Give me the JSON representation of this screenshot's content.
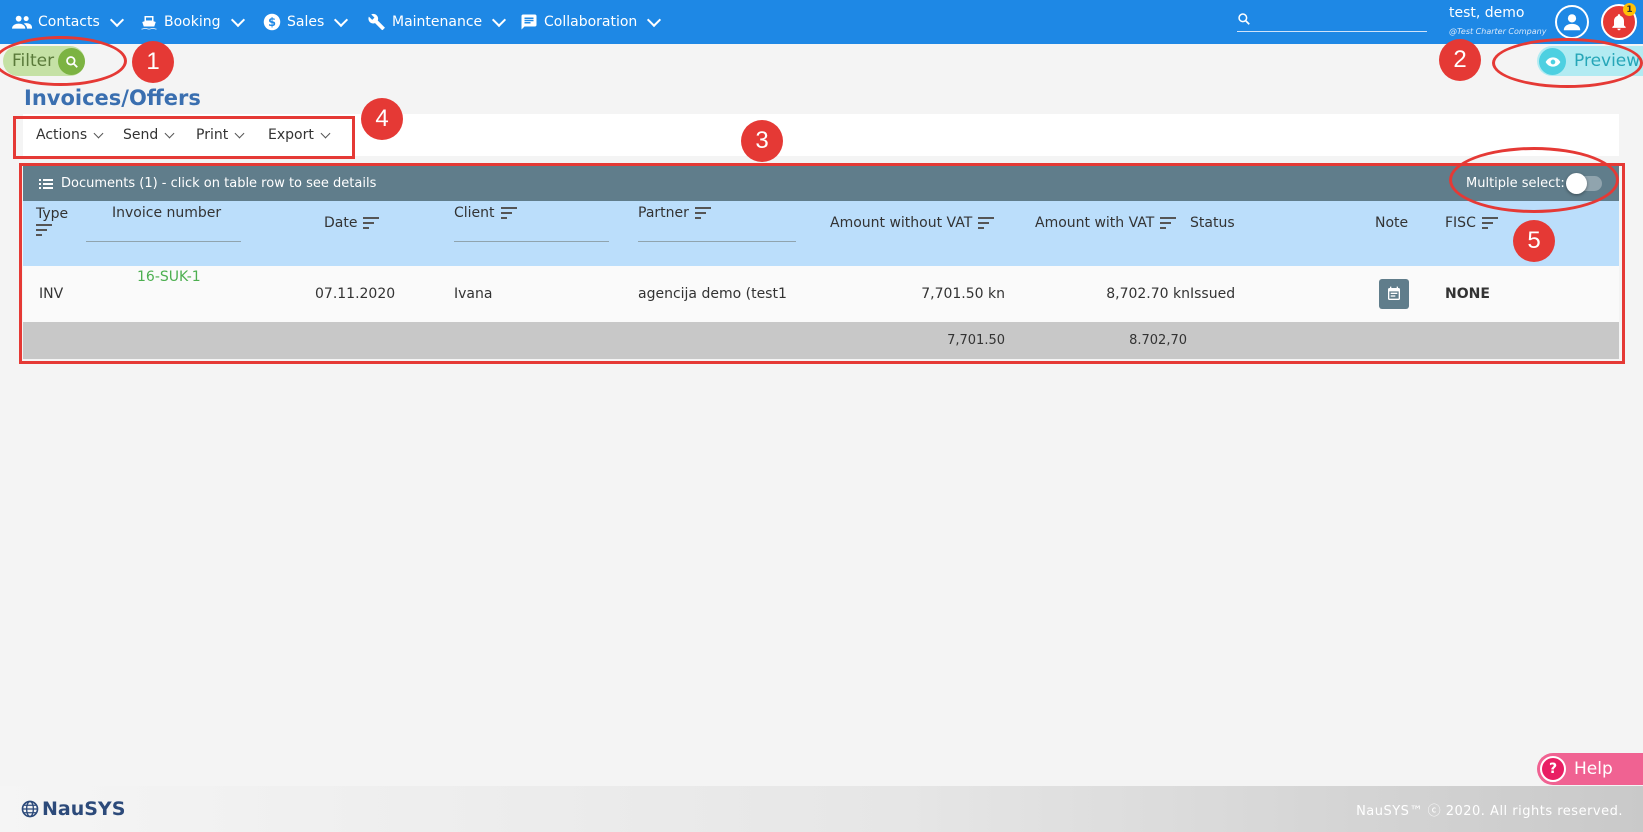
{
  "nav": {
    "items": [
      {
        "label": "Contacts",
        "icon": "people-icon"
      },
      {
        "label": "Booking",
        "icon": "boat-icon"
      },
      {
        "label": "Sales",
        "icon": "dollar-icon"
      },
      {
        "label": "Maintenance",
        "icon": "wrench-icon"
      },
      {
        "label": "Collaboration",
        "icon": "chat-icon"
      }
    ],
    "search_value": "",
    "user_name": "test, demo",
    "user_company": "@Test Charter Company",
    "notification_count": "1"
  },
  "filter": {
    "label": "Filter"
  },
  "preview": {
    "label": "Preview"
  },
  "page": {
    "title": "Invoices/Offers"
  },
  "toolbar": {
    "items": [
      "Actions",
      "Send",
      "Print",
      "Export"
    ]
  },
  "documents": {
    "title": "Documents (1) - click on table row to see details",
    "multiple_select_label": "Multiple select:",
    "multiple_select_on": false,
    "columns": {
      "type": "Type",
      "invoice_number": "Invoice number",
      "date": "Date",
      "client": "Client",
      "partner": "Partner",
      "amount_without_vat": "Amount without VAT",
      "amount_with_vat": "Amount with VAT",
      "status": "Status",
      "note": "Note",
      "fisc": "FISC"
    },
    "rows": [
      {
        "type": "INV",
        "invoice_number": "16-SUK-1",
        "date": "07.11.2020",
        "client": "Ivana",
        "partner": "agencija demo (test1",
        "amount_without_vat": "7,701.50 kn",
        "amount_with_vat": "8,702.70 kn",
        "status": "Issued",
        "fisc": "NONE"
      }
    ],
    "totals": {
      "amount_without_vat": "7,701.50",
      "amount_with_vat": "8.702,70"
    }
  },
  "annotations": [
    "1",
    "2",
    "3",
    "4",
    "5"
  ],
  "help": {
    "label": "Help"
  },
  "footer": {
    "logo": "NauSYS",
    "copyright": "NauSYS™ ⓒ 2020. All rights reserved."
  },
  "colors": {
    "nav_bg": "#1e88e5",
    "table_header_bg": "#607d8b",
    "column_header_bg": "#bbdefb",
    "annotation_red": "#e53935",
    "invoice_link": "#4caf50"
  }
}
